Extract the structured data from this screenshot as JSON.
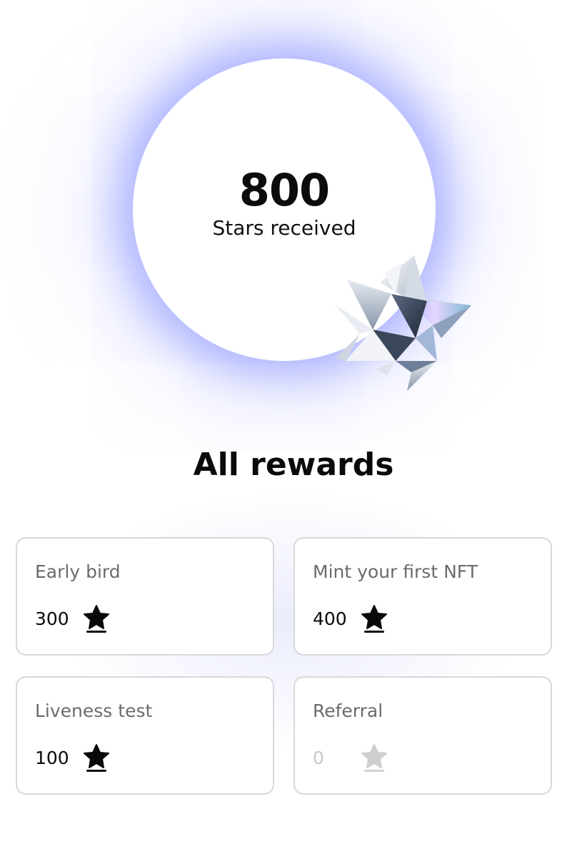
{
  "summary": {
    "stars_count": "800",
    "stars_caption": "Stars received"
  },
  "rewards": {
    "title": "All rewards",
    "items": [
      {
        "label": "Early bird",
        "points": "300",
        "earned": true
      },
      {
        "label": "Mint your first NFT",
        "points": "400",
        "earned": true
      },
      {
        "label": "Liveness test",
        "points": "100",
        "earned": true
      },
      {
        "label": "Referral",
        "points": "0",
        "earned": false
      }
    ]
  },
  "icons": {
    "reward_star": "star-icon",
    "hero_decoration": "crystal-star-icon"
  },
  "colors": {
    "glow": "#7480ff",
    "earned": "#0a0a0a",
    "not_earned": "#c8c8c8",
    "card_border": "#d8d8dc"
  }
}
